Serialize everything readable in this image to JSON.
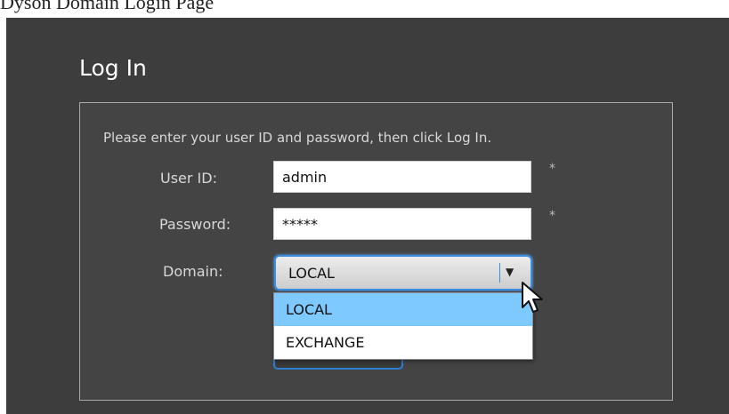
{
  "header": {
    "caption": "Dyson Domain Login Page"
  },
  "login": {
    "title": "Log In",
    "instructions": "Please enter your user ID and password, then click Log In.",
    "user_id_label": "User ID:",
    "user_id_value": "admin",
    "password_label": "Password:",
    "password_value": "*****",
    "required_marker": "*",
    "domain_label": "Domain:",
    "domain_selected": "LOCAL",
    "domain_arrow": "▼",
    "domain_options": [
      "LOCAL",
      "EXCHANGE"
    ]
  },
  "colors": {
    "background": "#3d3d3d",
    "selection": "#7ec9ff",
    "accent": "#3a8de0"
  },
  "icons": {
    "dropdown": "chevron-down-icon",
    "cursor": "mouse-pointer-icon"
  }
}
